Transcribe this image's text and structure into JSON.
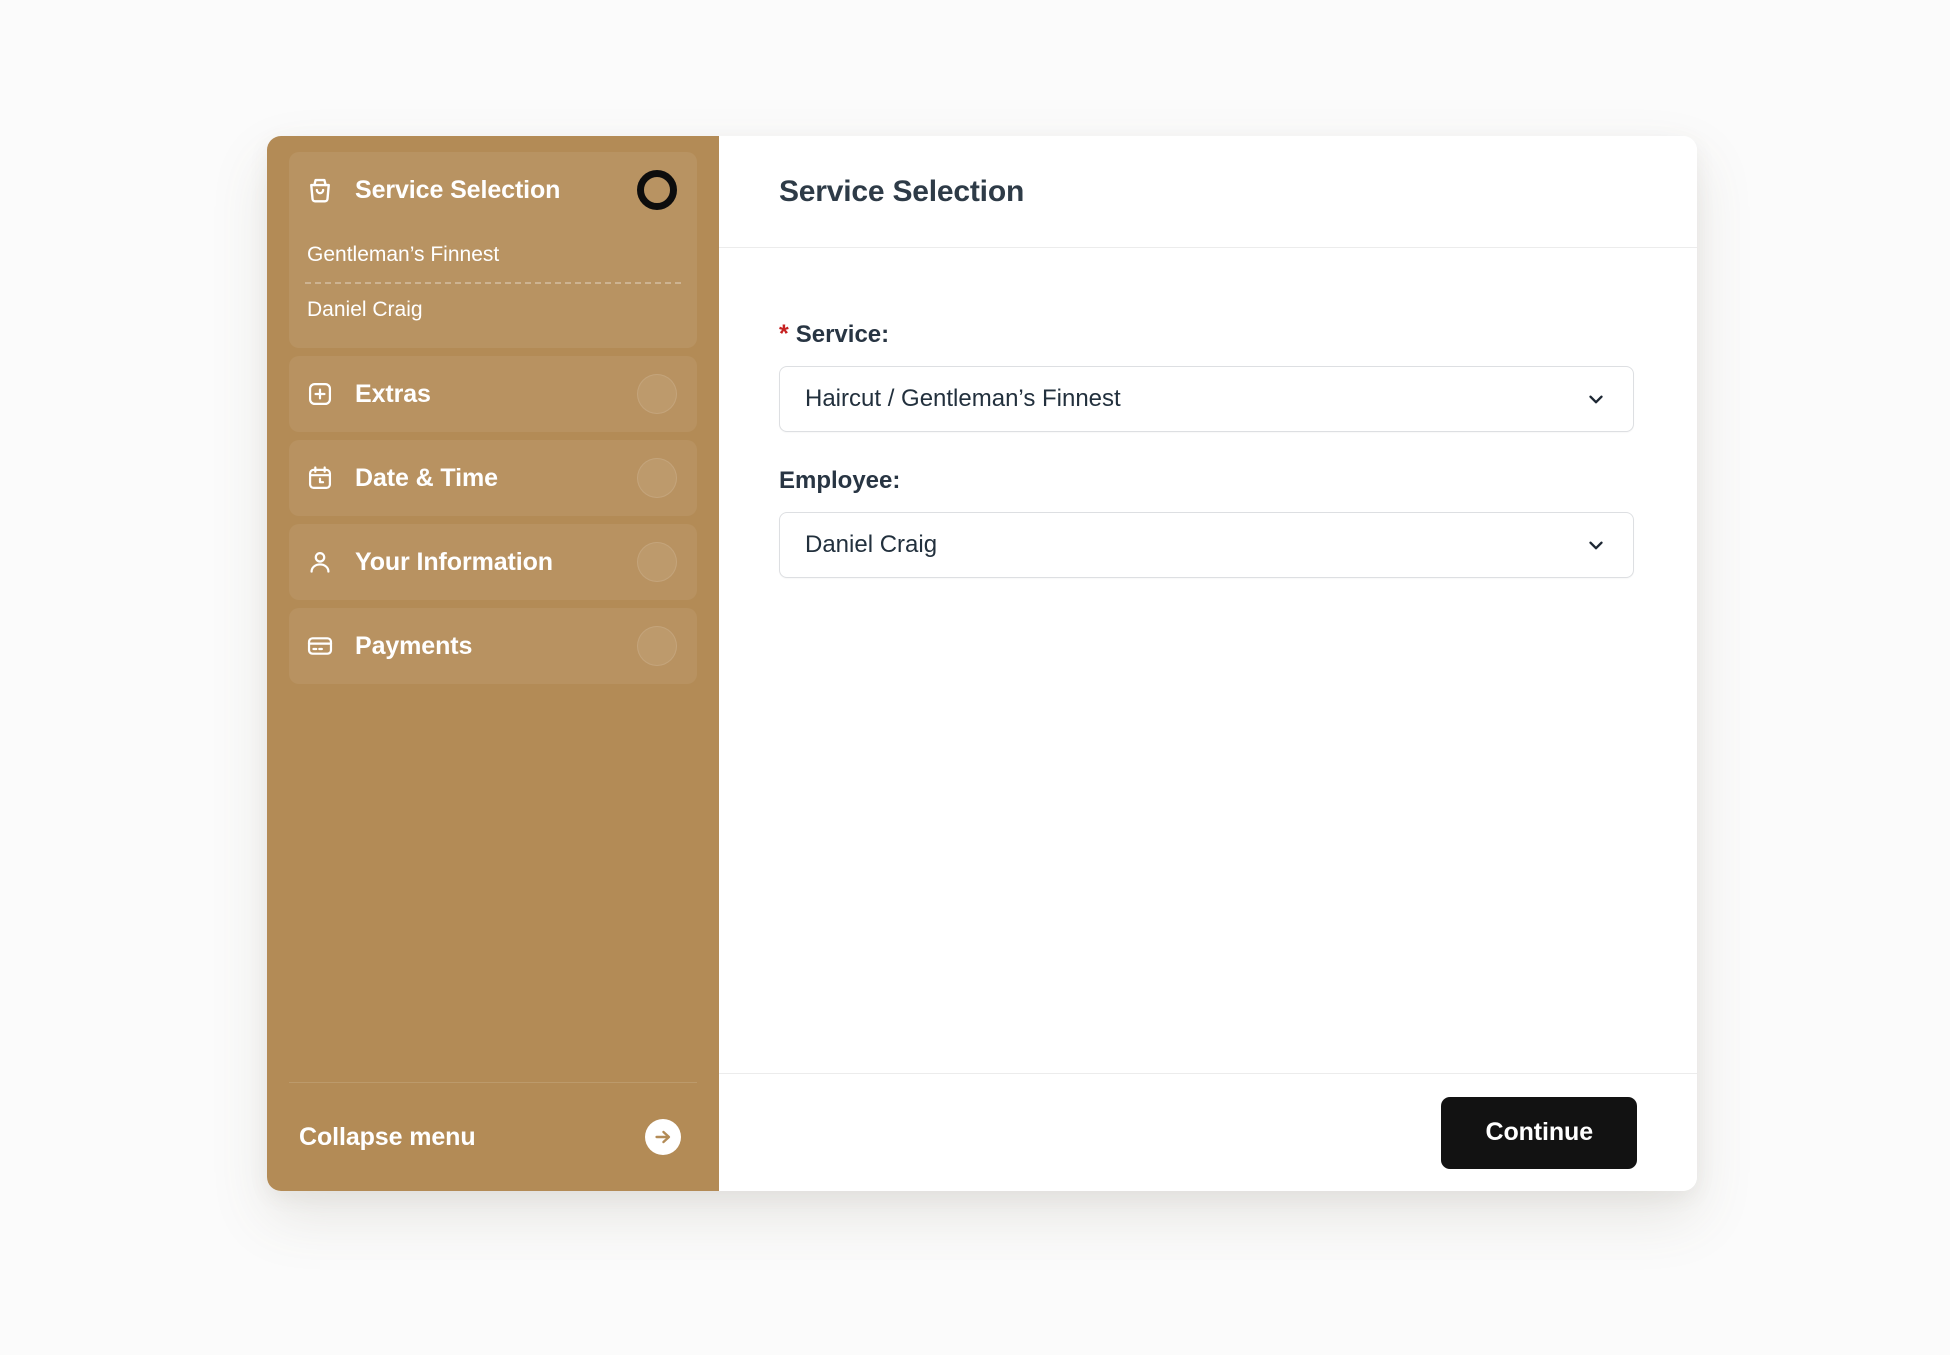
{
  "theme": {
    "sidebar_bg": "#b38b56",
    "accent_dark": "#121212",
    "required_star": "#c62121",
    "title_color": "#2e3b47",
    "page_bg": "#fbfbfb"
  },
  "sidebar": {
    "steps": [
      {
        "label": "Service Selection",
        "icon": "shopping-bag-icon",
        "state": "active",
        "details": [
          "Gentleman’s Finnest",
          "Daniel Craig"
        ]
      },
      {
        "label": "Extras",
        "icon": "plus-square-icon",
        "state": "idle",
        "details": []
      },
      {
        "label": "Date & Time",
        "icon": "calendar-clock-icon",
        "state": "idle",
        "details": []
      },
      {
        "label": "Your Information",
        "icon": "person-icon",
        "state": "idle",
        "details": []
      },
      {
        "label": "Payments",
        "icon": "credit-card-icon",
        "state": "idle",
        "details": []
      }
    ],
    "collapse": {
      "label": "Collapse menu",
      "icon": "arrow-right-circle-icon"
    }
  },
  "main": {
    "title": "Service Selection",
    "fields": [
      {
        "label": "Service:",
        "required": true,
        "required_marker": "*",
        "value": "Haircut / Gentleman’s Finnest",
        "chevron": "chevron-down-icon"
      },
      {
        "label": "Employee:",
        "required": false,
        "required_marker": "",
        "value": "Daniel Craig",
        "chevron": "chevron-down-icon"
      }
    ],
    "footer": {
      "continue_label": "Continue"
    }
  }
}
